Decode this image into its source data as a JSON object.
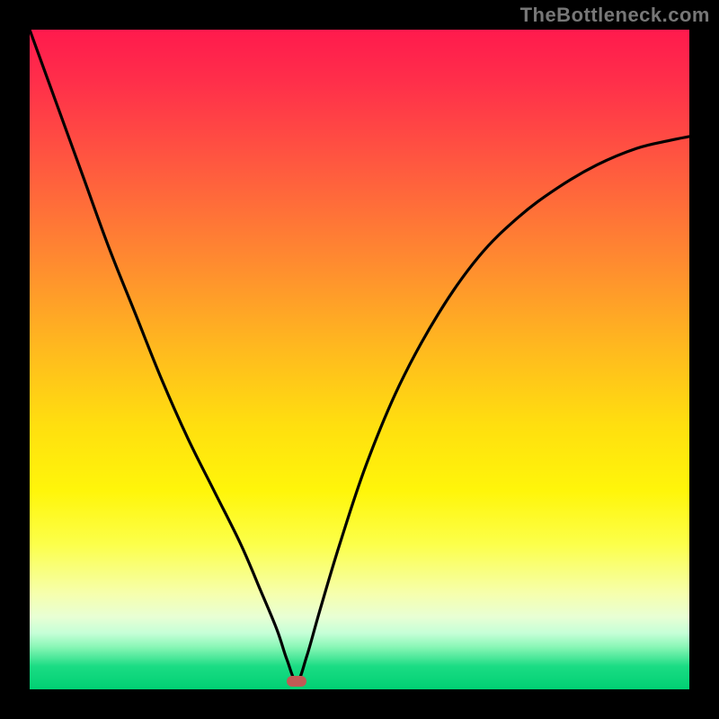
{
  "watermark": "TheBottleneck.com",
  "colors": {
    "background": "#000000",
    "gradient_top": "#ff1a4d",
    "gradient_mid": "#ffe600",
    "gradient_bottom": "#00d073",
    "curve": "#000000",
    "marker": "#c15a55",
    "watermark_text": "#777777"
  },
  "chart_data": {
    "type": "line",
    "title": "",
    "xlabel": "",
    "ylabel": "",
    "xlim": [
      0,
      100
    ],
    "ylim": [
      0,
      100
    ],
    "grid": false,
    "legend": false,
    "annotations": [
      {
        "kind": "marker",
        "x": 40.5,
        "y": 1.2,
        "shape": "rounded-rect",
        "color": "#c15a55"
      }
    ],
    "series": [
      {
        "name": "bottleneck-curve",
        "color": "#000000",
        "x": [
          0,
          4,
          8,
          12,
          16,
          20,
          24,
          28,
          32,
          35,
          37.5,
          39,
          40.5,
          42,
          44,
          47,
          51,
          56,
          62,
          68,
          74,
          80,
          86,
          92,
          97,
          100
        ],
        "y": [
          100,
          89,
          78,
          67,
          57,
          47,
          38,
          30,
          22,
          15,
          9,
          4.5,
          1.2,
          5,
          12,
          22,
          34,
          46,
          57,
          65.5,
          71.5,
          76,
          79.5,
          82,
          83.2,
          83.8
        ]
      }
    ],
    "background_gradient_stops": [
      {
        "pos": 0,
        "color": "#ff1a4d"
      },
      {
        "pos": 0.35,
        "color": "#ff8a30"
      },
      {
        "pos": 0.6,
        "color": "#ffdf0f"
      },
      {
        "pos": 0.86,
        "color": "#f6ffad"
      },
      {
        "pos": 1.0,
        "color": "#00d073"
      }
    ]
  },
  "layout": {
    "image_size": 800,
    "border": 33,
    "plot_size": 734
  }
}
